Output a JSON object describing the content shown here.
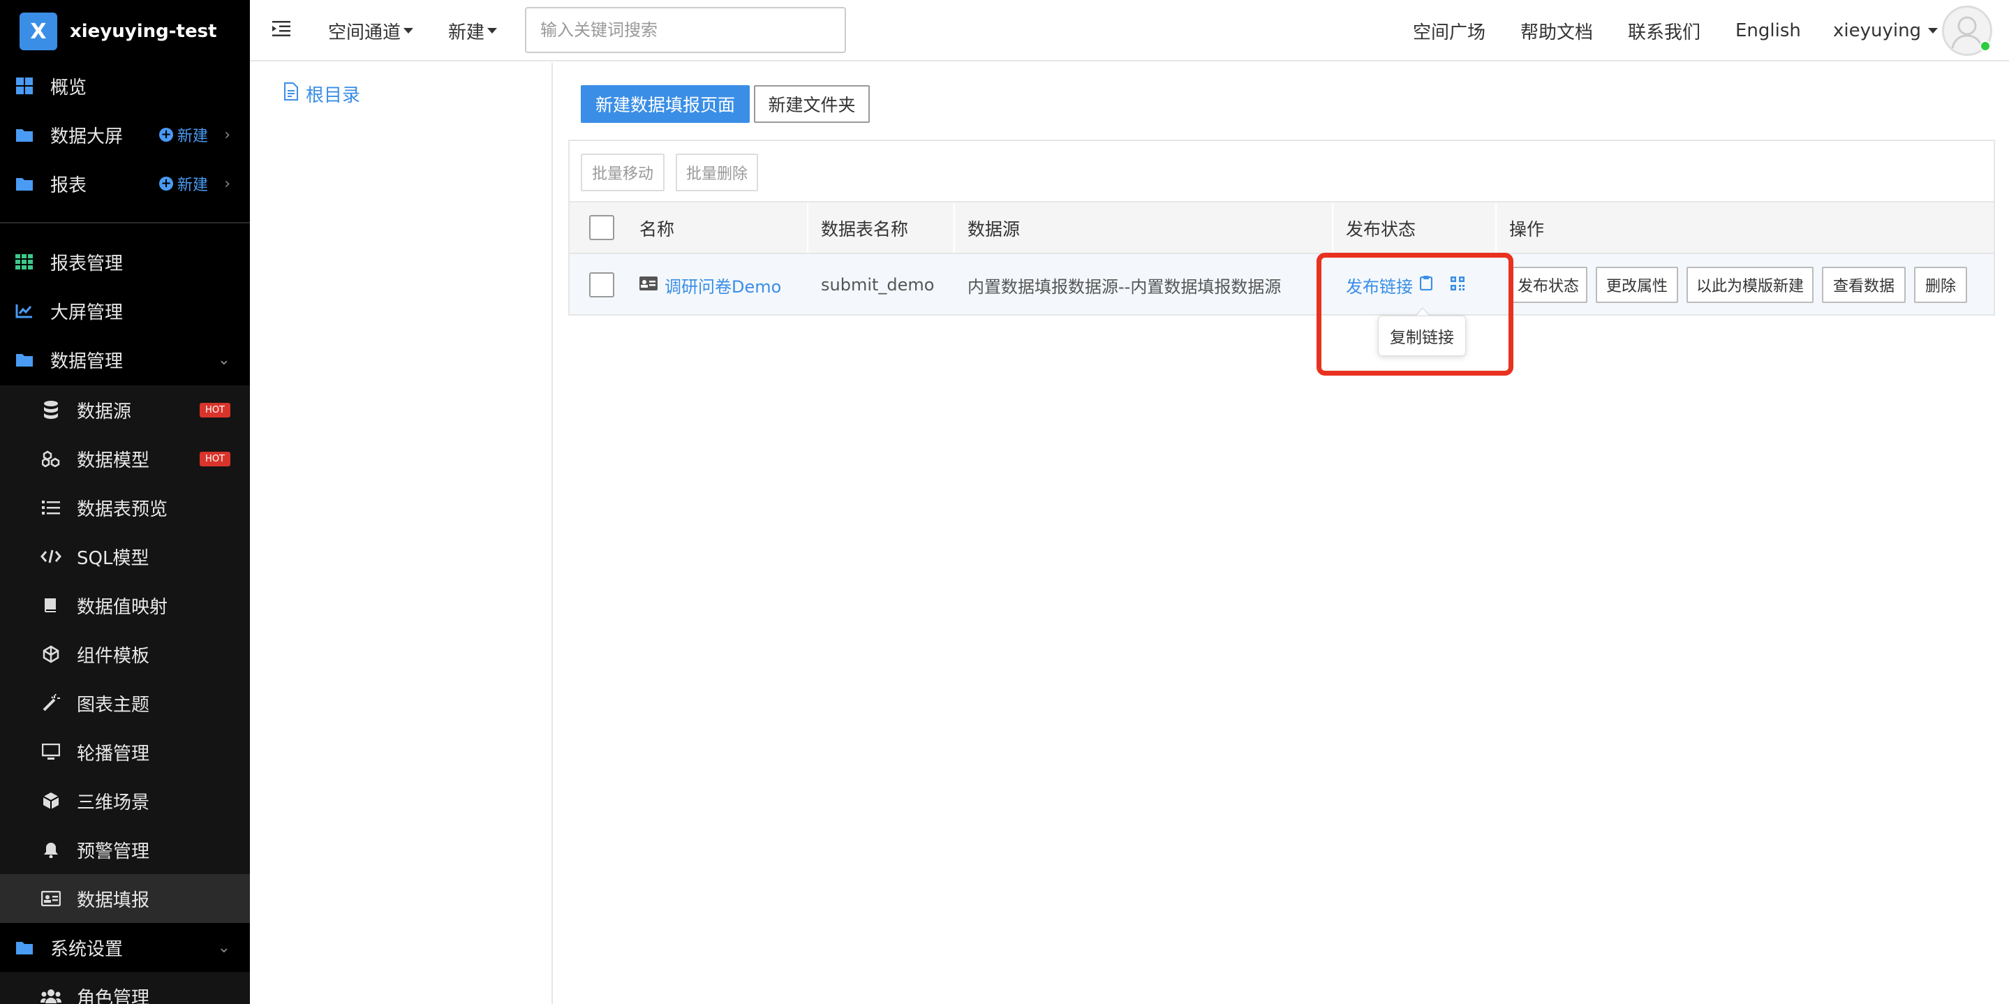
{
  "brand": {
    "logo_letter": "X",
    "name": "xieyuying-test"
  },
  "sidebar": {
    "new_label": "新建",
    "hot_label": "HOT",
    "items": [
      {
        "label": "概览",
        "icon": "dashboard-icon"
      },
      {
        "label": "数据大屏",
        "icon": "folder-icon"
      },
      {
        "label": "报表",
        "icon": "folder-icon"
      },
      {
        "label": "报表管理",
        "icon": "grid-icon"
      },
      {
        "label": "大屏管理",
        "icon": "chart-line-icon"
      },
      {
        "label": "数据管理",
        "icon": "folder-icon"
      },
      {
        "label": "数据源",
        "icon": "database-icon"
      },
      {
        "label": "数据模型",
        "icon": "cubes-icon"
      },
      {
        "label": "数据表预览",
        "icon": "list-icon"
      },
      {
        "label": "SQL模型",
        "icon": "code-icon"
      },
      {
        "label": "数据值映射",
        "icon": "book-icon"
      },
      {
        "label": "组件模板",
        "icon": "component-icon"
      },
      {
        "label": "图表主题",
        "icon": "magic-wand-icon"
      },
      {
        "label": "轮播管理",
        "icon": "monitor-icon"
      },
      {
        "label": "三维场景",
        "icon": "cube-icon"
      },
      {
        "label": "预警管理",
        "icon": "bell-icon"
      },
      {
        "label": "数据填报",
        "icon": "id-card-icon"
      },
      {
        "label": "系统设置",
        "icon": "folder-icon"
      },
      {
        "label": "角色管理",
        "icon": "users-icon"
      }
    ]
  },
  "topbar": {
    "space_channel": "空间通道",
    "new": "新建",
    "search_placeholder": "输入关键词搜索",
    "space_square": "空间广场",
    "help_docs": "帮助文档",
    "contact_us": "联系我们",
    "language": "English",
    "username": "xieyuying"
  },
  "tree": {
    "root_label": "根目录"
  },
  "main": {
    "new_form_page": "新建数据填报页面",
    "new_folder": "新建文件夹",
    "batch_move": "批量移动",
    "batch_delete": "批量删除",
    "columns": {
      "name": "名称",
      "table_name": "数据表名称",
      "datasource": "数据源",
      "publish_status": "发布状态",
      "actions": "操作"
    },
    "rows": [
      {
        "name": "调研问卷Demo",
        "table_name": "submit_demo",
        "datasource": "内置数据填报数据源--内置数据填报数据源",
        "publish_link": "发布链接",
        "actions": [
          "发布状态",
          "更改属性",
          "以此为模版新建",
          "查看数据",
          "删除"
        ]
      }
    ],
    "tooltip": "复制链接"
  },
  "colors": {
    "accent": "#3a8ee6",
    "highlight": "#e8321f",
    "hot": "#d9342b",
    "sidebar_bg": "#000000"
  }
}
